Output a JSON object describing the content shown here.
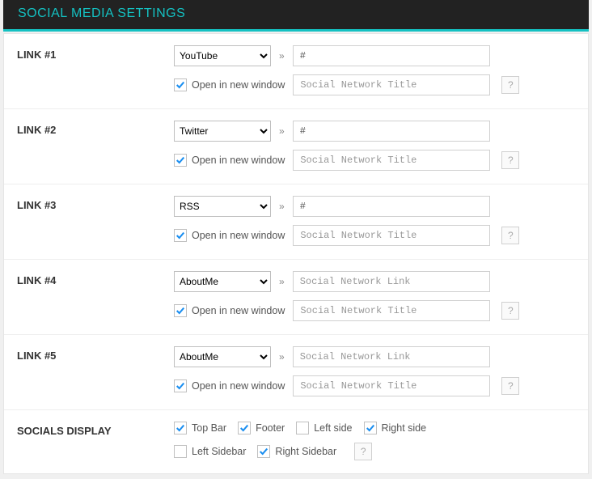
{
  "header_title": "SOCIAL MEDIA SETTINGS",
  "common": {
    "arrow": "»",
    "help_label": "?",
    "open_new_window": "Open in new window",
    "link_placeholder": "Social Network Link",
    "title_placeholder": "Social Network Title"
  },
  "links": [
    {
      "label": "LINK #1",
      "network": "YouTube",
      "url": "#",
      "title": "",
      "new_window": true
    },
    {
      "label": "LINK #2",
      "network": "Twitter",
      "url": "#",
      "title": "",
      "new_window": true
    },
    {
      "label": "LINK #3",
      "network": "RSS",
      "url": "#",
      "title": "",
      "new_window": true
    },
    {
      "label": "LINK #4",
      "network": "AboutMe",
      "url": "",
      "title": "",
      "new_window": true
    },
    {
      "label": "LINK #5",
      "network": "AboutMe",
      "url": "",
      "title": "",
      "new_window": true
    }
  ],
  "display": {
    "label": "SOCIALS DISPLAY",
    "options": [
      {
        "label": "Top Bar",
        "checked": true
      },
      {
        "label": "Footer",
        "checked": true
      },
      {
        "label": "Left side",
        "checked": false
      },
      {
        "label": "Right side",
        "checked": true
      },
      {
        "label": "Left Sidebar",
        "checked": false
      },
      {
        "label": "Right Sidebar",
        "checked": true
      }
    ]
  }
}
